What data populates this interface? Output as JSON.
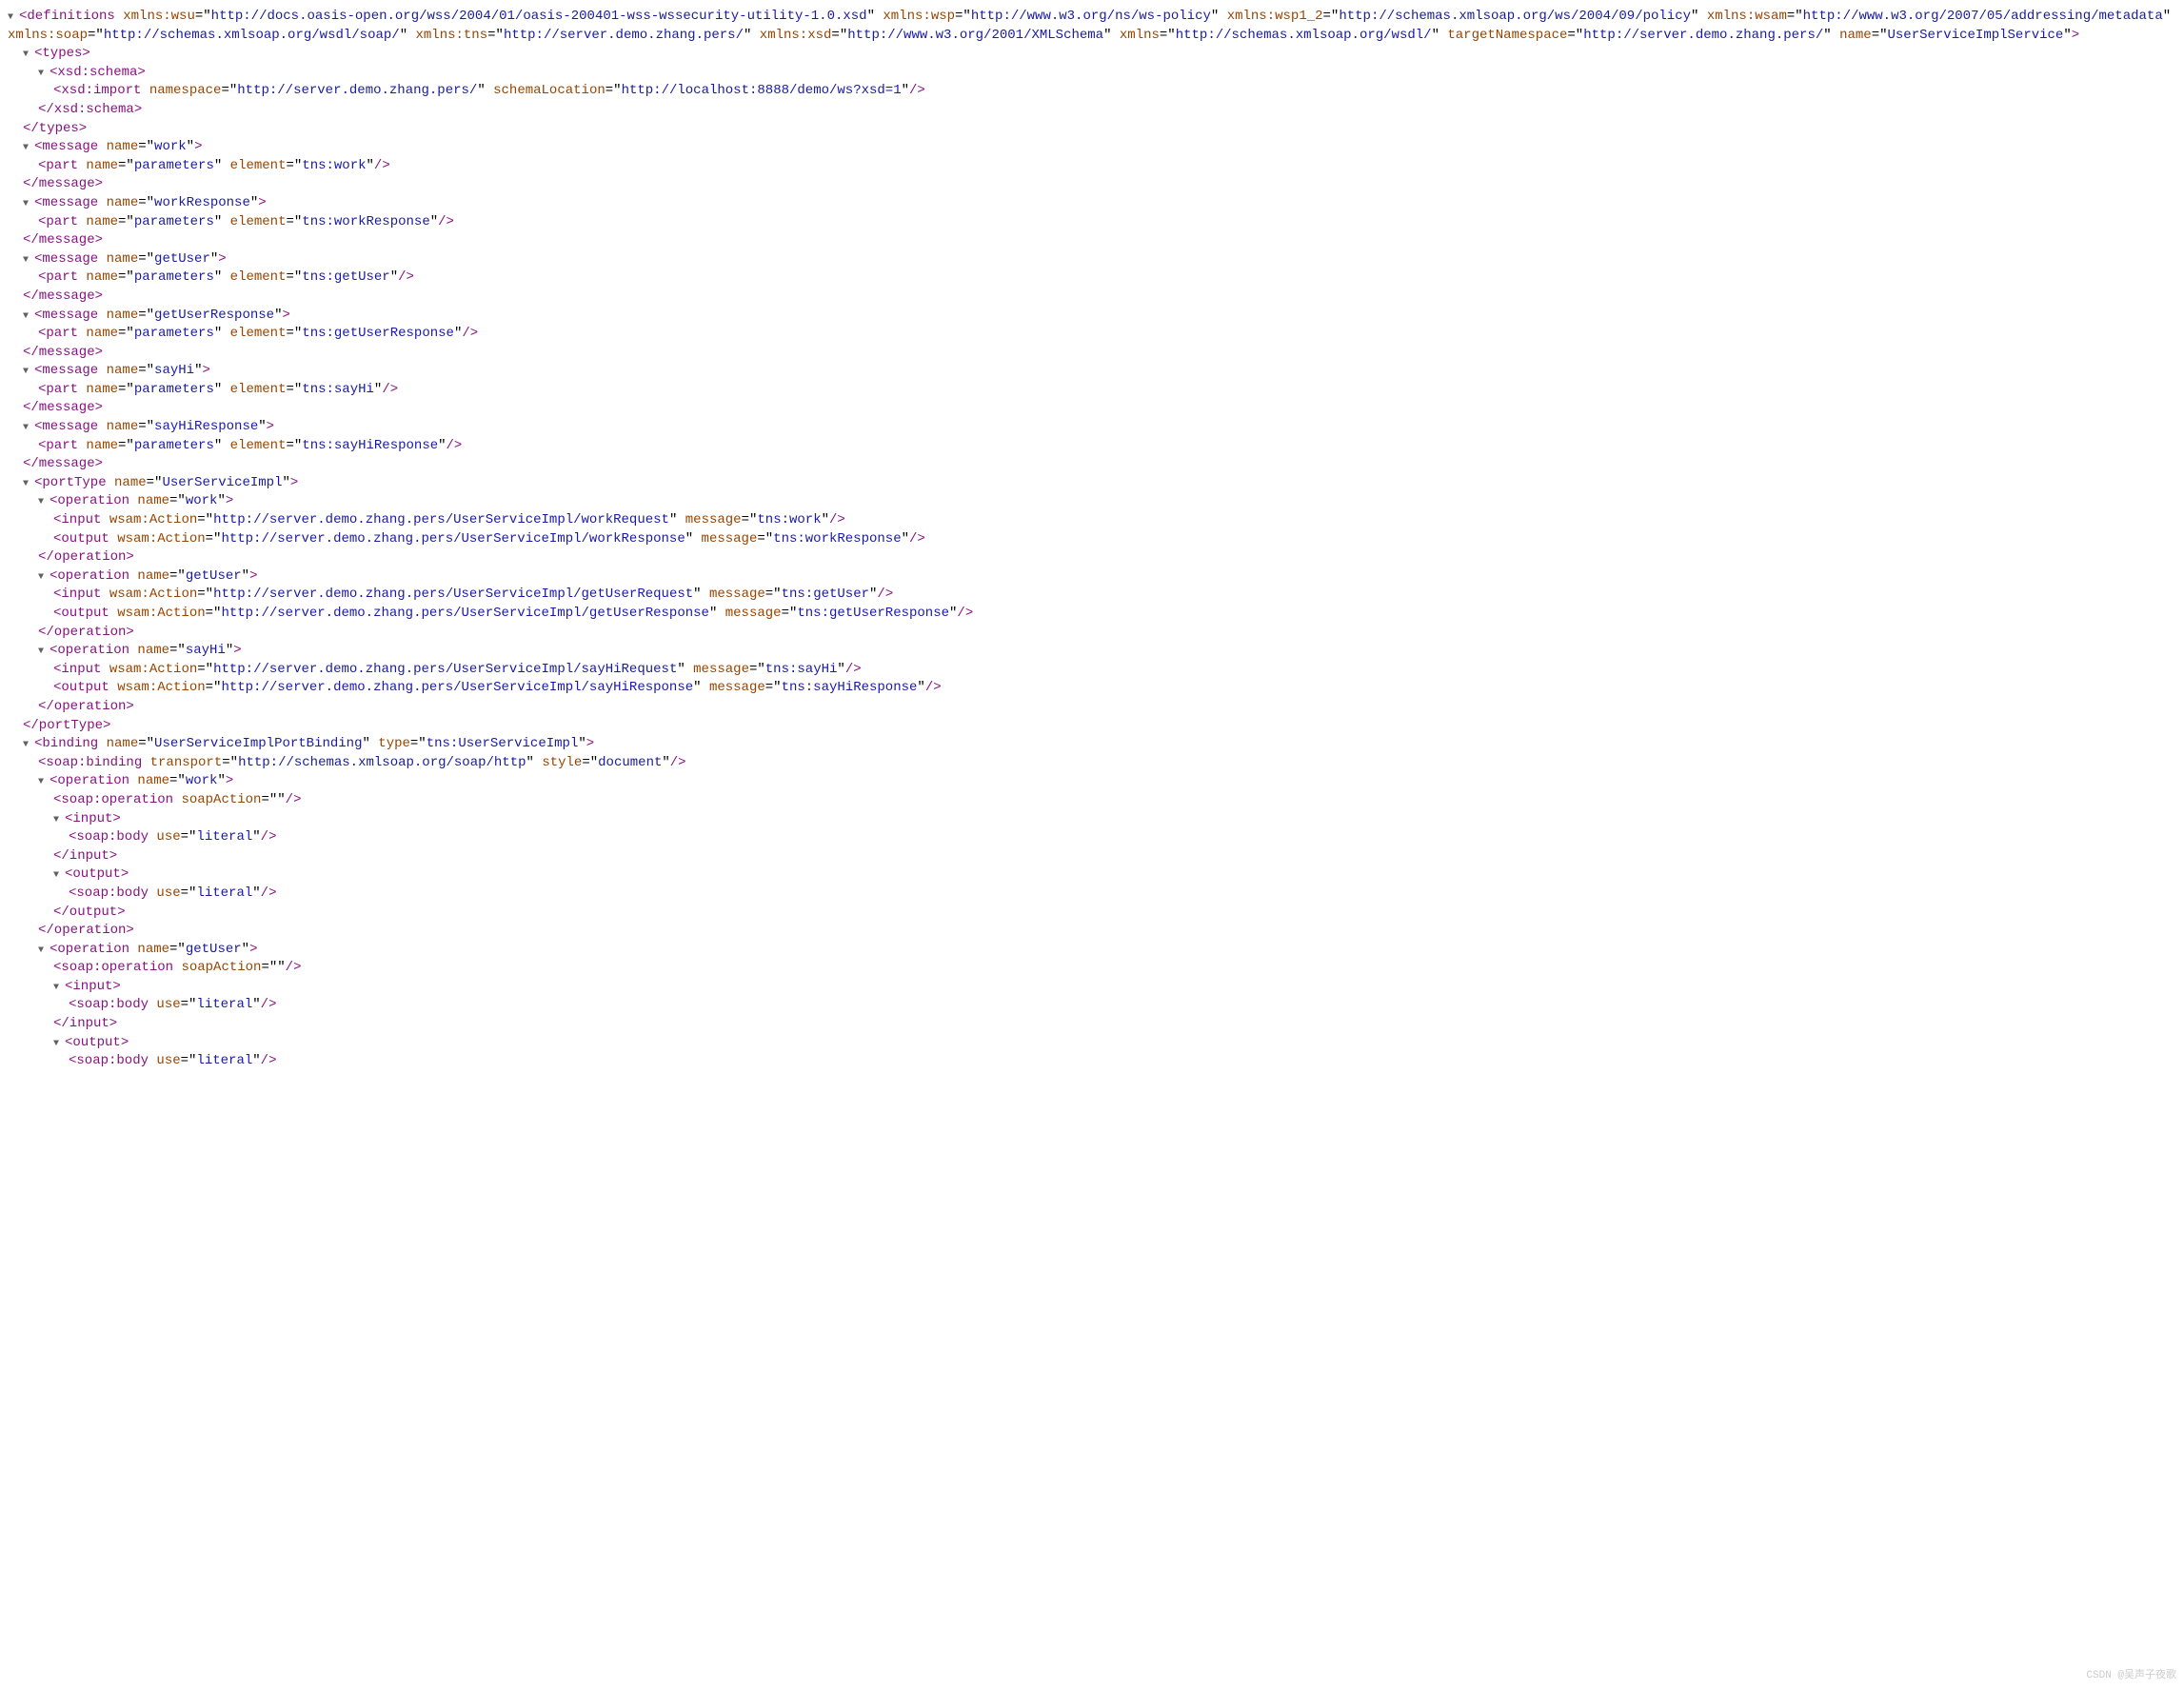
{
  "arrow": "▼",
  "defs": {
    "ns": {
      "wsu": "http://docs.oasis-open.org/wss/2004/01/oasis-200401-wss-wssecurity-utility-1.0.xsd",
      "wsp": "http://www.w3.org/ns/ws-policy",
      "wsp1_2": "http://schemas.xmlsoap.org/ws/2004/09/policy",
      "wsam": "http://www.w3.org/2007/05/addressing/metadata",
      "soap": "http://schemas.xmlsoap.org/wsdl/soap/",
      "tns": "http://server.demo.zhang.pers/",
      "xsd": "http://www.w3.org/2001/XMLSchema",
      "xmlns": "http://schemas.xmlsoap.org/wsdl/"
    },
    "targetNamespace": "http://server.demo.zhang.pers/",
    "name": "UserServiceImplService"
  },
  "xsdImport": {
    "namespace": "http://server.demo.zhang.pers/",
    "schemaLocation": "http://localhost:8888/demo/ws?xsd=1"
  },
  "messages": [
    {
      "name": "work",
      "part": "parameters",
      "element": "tns:work"
    },
    {
      "name": "workResponse",
      "part": "parameters",
      "element": "tns:workResponse"
    },
    {
      "name": "getUser",
      "part": "parameters",
      "element": "tns:getUser"
    },
    {
      "name": "getUserResponse",
      "part": "parameters",
      "element": "tns:getUserResponse"
    },
    {
      "name": "sayHi",
      "part": "parameters",
      "element": "tns:sayHi"
    },
    {
      "name": "sayHiResponse",
      "part": "parameters",
      "element": "tns:sayHiResponse"
    }
  ],
  "portType": {
    "name": "UserServiceImpl",
    "ops": [
      {
        "name": "work",
        "inAction": "http://server.demo.zhang.pers/UserServiceImpl/workRequest",
        "inMsg": "tns:work",
        "outAction": "http://server.demo.zhang.pers/UserServiceImpl/workResponse",
        "outMsg": "tns:workResponse"
      },
      {
        "name": "getUser",
        "inAction": "http://server.demo.zhang.pers/UserServiceImpl/getUserRequest",
        "inMsg": "tns:getUser",
        "outAction": "http://server.demo.zhang.pers/UserServiceImpl/getUserResponse",
        "outMsg": "tns:getUserResponse"
      },
      {
        "name": "sayHi",
        "inAction": "http://server.demo.zhang.pers/UserServiceImpl/sayHiRequest",
        "inMsg": "tns:sayHi",
        "outAction": "http://server.demo.zhang.pers/UserServiceImpl/sayHiResponse",
        "outMsg": "tns:sayHiResponse"
      }
    ]
  },
  "binding": {
    "name": "UserServiceImplPortBinding",
    "type": "tns:UserServiceImpl",
    "soapBinding": {
      "transport": "http://schemas.xmlsoap.org/soap/http",
      "style": "document"
    },
    "ops": [
      {
        "name": "work",
        "soapAction": "",
        "inUse": "literal",
        "outUse": "literal",
        "complete": true
      },
      {
        "name": "getUser",
        "soapAction": "",
        "inUse": "literal",
        "outUse": "literal",
        "complete": false
      }
    ]
  },
  "watermark": "CSDN @吴声子夜歌"
}
